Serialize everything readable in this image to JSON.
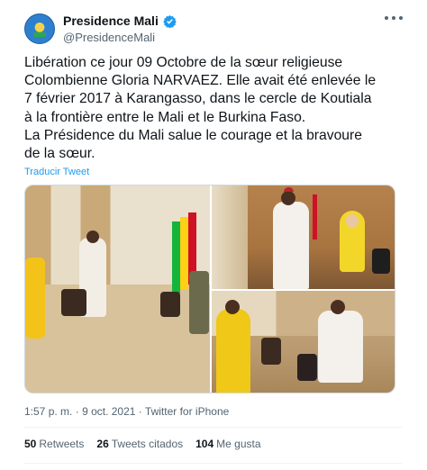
{
  "author": {
    "display_name": "Presidence Mali",
    "handle": "@PresidenceMali",
    "verified_icon": "verified-badge-icon",
    "avatar_icon": "coat-of-arms-icon"
  },
  "tweet": {
    "text": "Libération ce jour 09 Octobre de la sœur religieuse\nColombienne Gloria NARVAEZ. Elle avait été enlevée le\n7 février 2017 à Karangasso, dans le cercle de Koutiala\nà la frontière  entre le Mali et le Burkina Faso.\nLa Présidence du Mali salue le courage et la bravoure\nde la sœur.",
    "translate_label": "Traducir Tweet"
  },
  "meta": {
    "time": "1:57 p. m.",
    "separator": "·",
    "date": "9 oct. 2021",
    "source": "Twitter for iPhone"
  },
  "stats": {
    "retweets_count": "50",
    "retweets_label": "Retweets",
    "quotes_count": "26",
    "quotes_label": "Tweets citados",
    "likes_count": "104",
    "likes_label": "Me gusta"
  },
  "colors": {
    "accent": "#1d9bf0",
    "text": "#0f1419",
    "secondary": "#536471",
    "mali_green": "#14b53a",
    "mali_yellow": "#fcd116",
    "mali_red": "#ce1126"
  }
}
